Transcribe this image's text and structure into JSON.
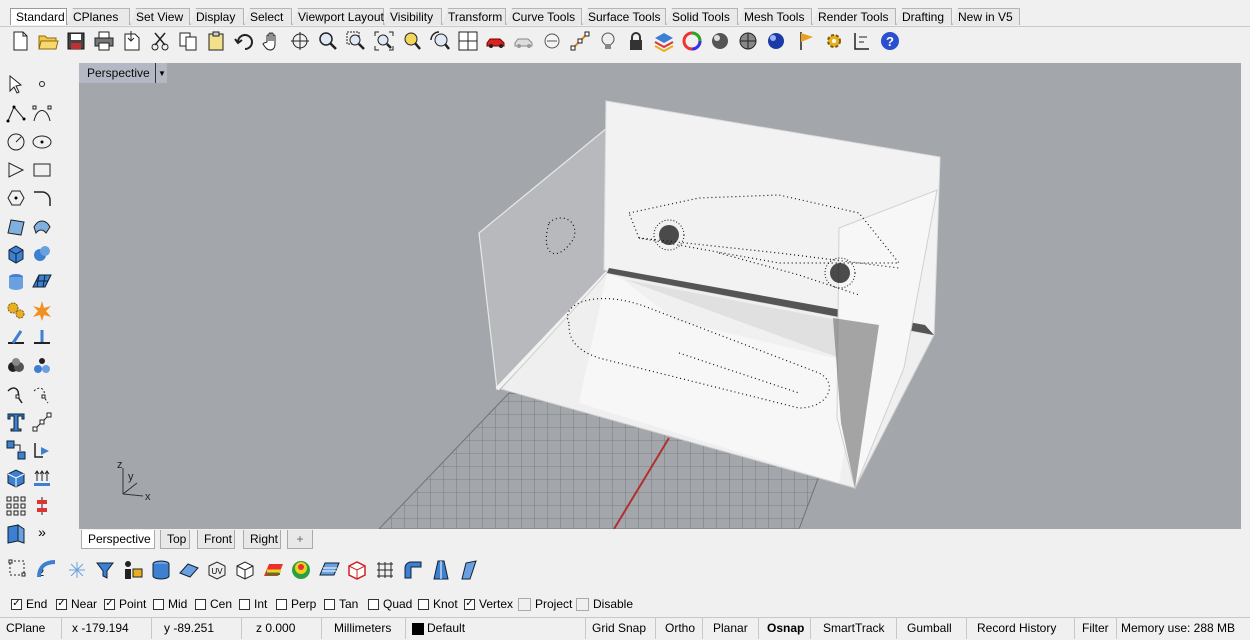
{
  "toolbar_tabs": [
    "Standard",
    "CPlanes",
    "Set View",
    "Display",
    "Select",
    "Viewport Layout",
    "Visibility",
    "Transform",
    "Curve Tools",
    "Surface Tools",
    "Solid Tools",
    "Mesh Tools",
    "Render Tools",
    "Drafting",
    "New in V5"
  ],
  "viewport": {
    "label": "Perspective",
    "axis_z": "z",
    "axis_y": "y",
    "axis_x": "x"
  },
  "view_tabs": [
    "Perspective",
    "Top",
    "Front",
    "Right",
    "+"
  ],
  "left_text": {
    "small_two": "2",
    "more": "»"
  },
  "osnap": [
    {
      "label": "End",
      "checked": true
    },
    {
      "label": "Near",
      "checked": true
    },
    {
      "label": "Point",
      "checked": true
    },
    {
      "label": "Mid",
      "checked": false
    },
    {
      "label": "Cen",
      "checked": false
    },
    {
      "label": "Int",
      "checked": false
    },
    {
      "label": "Perp",
      "checked": false
    },
    {
      "label": "Tan",
      "checked": false
    },
    {
      "label": "Quad",
      "checked": false
    },
    {
      "label": "Knot",
      "checked": false
    },
    {
      "label": "Vertex",
      "checked": true
    },
    {
      "label": "Project",
      "checked": false
    },
    {
      "label": "Disable",
      "checked": false
    }
  ],
  "status": {
    "cplane": "CPlane",
    "x": "x -179.194",
    "y": "y -89.251",
    "z": "z 0.000",
    "units": "Millimeters",
    "layer": "Default",
    "grid_snap": "Grid Snap",
    "ortho": "Ortho",
    "planar": "Planar",
    "osnap": "Osnap",
    "smarttrack": "SmartTrack",
    "gumball": "Gumball",
    "record_history": "Record History",
    "filter": "Filter",
    "memory": "Memory use: 288 MB"
  },
  "colors": {
    "viewport_bg": "#a3a7ac",
    "layer_swatch": "#000000",
    "x_axis": "#b03030"
  }
}
